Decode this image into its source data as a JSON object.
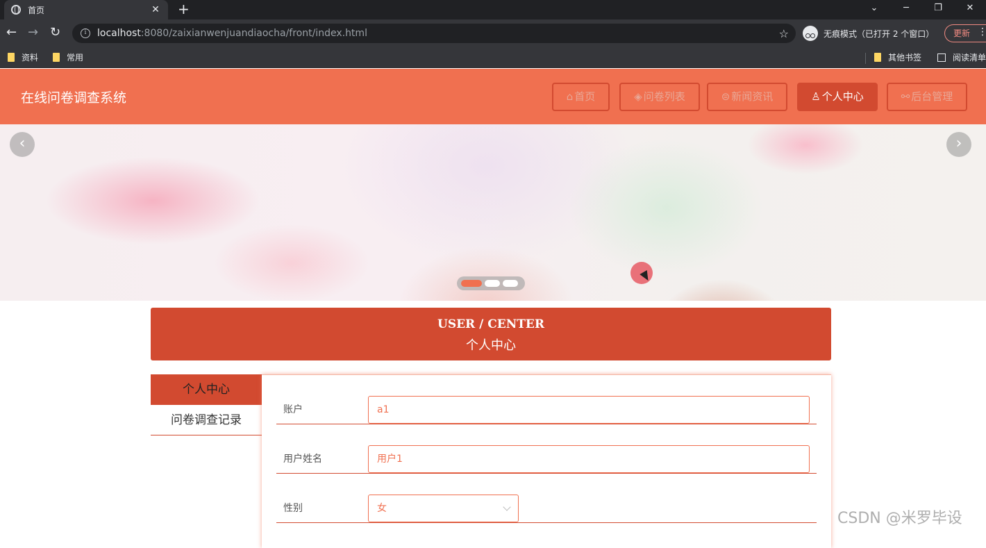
{
  "browser": {
    "tab_title": "首页",
    "tab_close": "✕",
    "new_tab": "+",
    "url_host": "localhost",
    "url_path": ":8080/zaixianwenjuandiaocha/front/index.html",
    "incognito_label": "无痕模式（已打开 2 个窗口）",
    "update_label": "更新",
    "bookmarks": [
      "资料",
      "常用"
    ],
    "other_bookmarks": "其他书签",
    "reading_list": "阅读清单"
  },
  "site": {
    "title": "在线问卷调查系统",
    "nav": [
      {
        "icon": "⌂",
        "label": "首页"
      },
      {
        "icon": "◈",
        "label": "问卷列表"
      },
      {
        "icon": "⊜",
        "label": "新闻资讯"
      },
      {
        "icon": "♙",
        "label": "个人中心"
      },
      {
        "icon": "⚯",
        "label": "后台管理"
      }
    ],
    "active_nav": "个人中心",
    "accent_color": "#f07050",
    "accent_dark": "#d24a30"
  },
  "banner": {
    "prev": "‹",
    "next": "›",
    "slide_count": 3,
    "active_slide": 1
  },
  "section": {
    "title_en": "USER / CENTER",
    "title_zh": "个人中心"
  },
  "sidebar": {
    "items": [
      "个人中心",
      "问卷调查记录"
    ],
    "active": "个人中心"
  },
  "form": {
    "account_label": "账户",
    "account_value": "a1",
    "name_label": "用户姓名",
    "name_value": "用户1",
    "gender_label": "性别",
    "gender_value": "女"
  },
  "watermark": "CSDN @米罗毕设"
}
